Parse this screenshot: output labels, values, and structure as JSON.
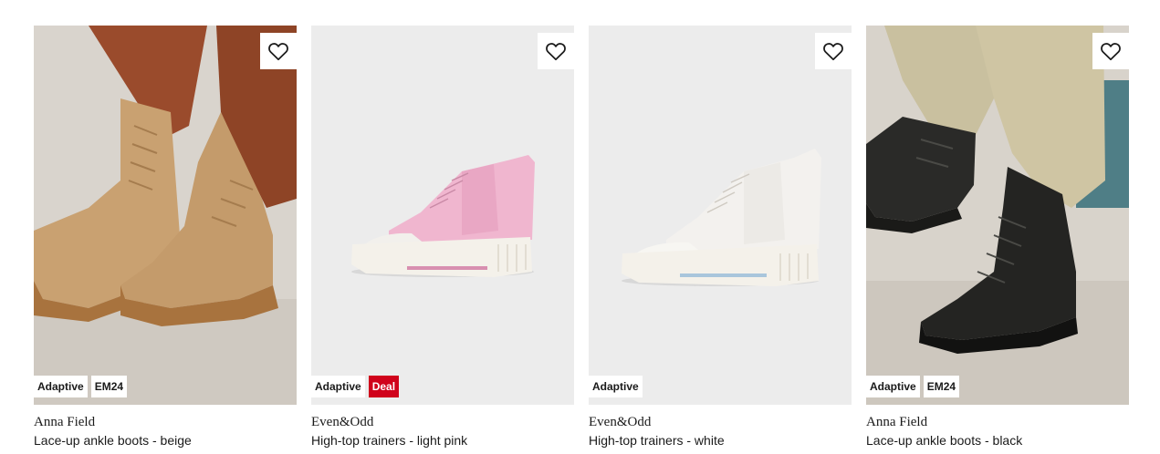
{
  "products": [
    {
      "brand": "Anna Field",
      "name": "Lace-up ankle boots - beige",
      "badges": [
        {
          "label": "Adaptive",
          "kind": "default"
        },
        {
          "label": "EM24",
          "kind": "default"
        }
      ],
      "wishlist_icon": "heart-outline-icon"
    },
    {
      "brand": "Even&Odd",
      "name": "High-top trainers - light pink",
      "badges": [
        {
          "label": "Adaptive",
          "kind": "default"
        },
        {
          "label": "Deal",
          "kind": "deal"
        }
      ],
      "wishlist_icon": "heart-outline-icon"
    },
    {
      "brand": "Even&Odd",
      "name": "High-top trainers - white",
      "badges": [
        {
          "label": "Adaptive",
          "kind": "default"
        }
      ],
      "wishlist_icon": "heart-outline-icon"
    },
    {
      "brand": "Anna Field",
      "name": "Lace-up ankle boots - black",
      "badges": [
        {
          "label": "Adaptive",
          "kind": "default"
        },
        {
          "label": "EM24",
          "kind": "default"
        }
      ],
      "wishlist_icon": "heart-outline-icon"
    }
  ],
  "colors": {
    "deal_badge": "#d0021b",
    "text": "#1a1a1a",
    "image_bg": "#ededed"
  }
}
